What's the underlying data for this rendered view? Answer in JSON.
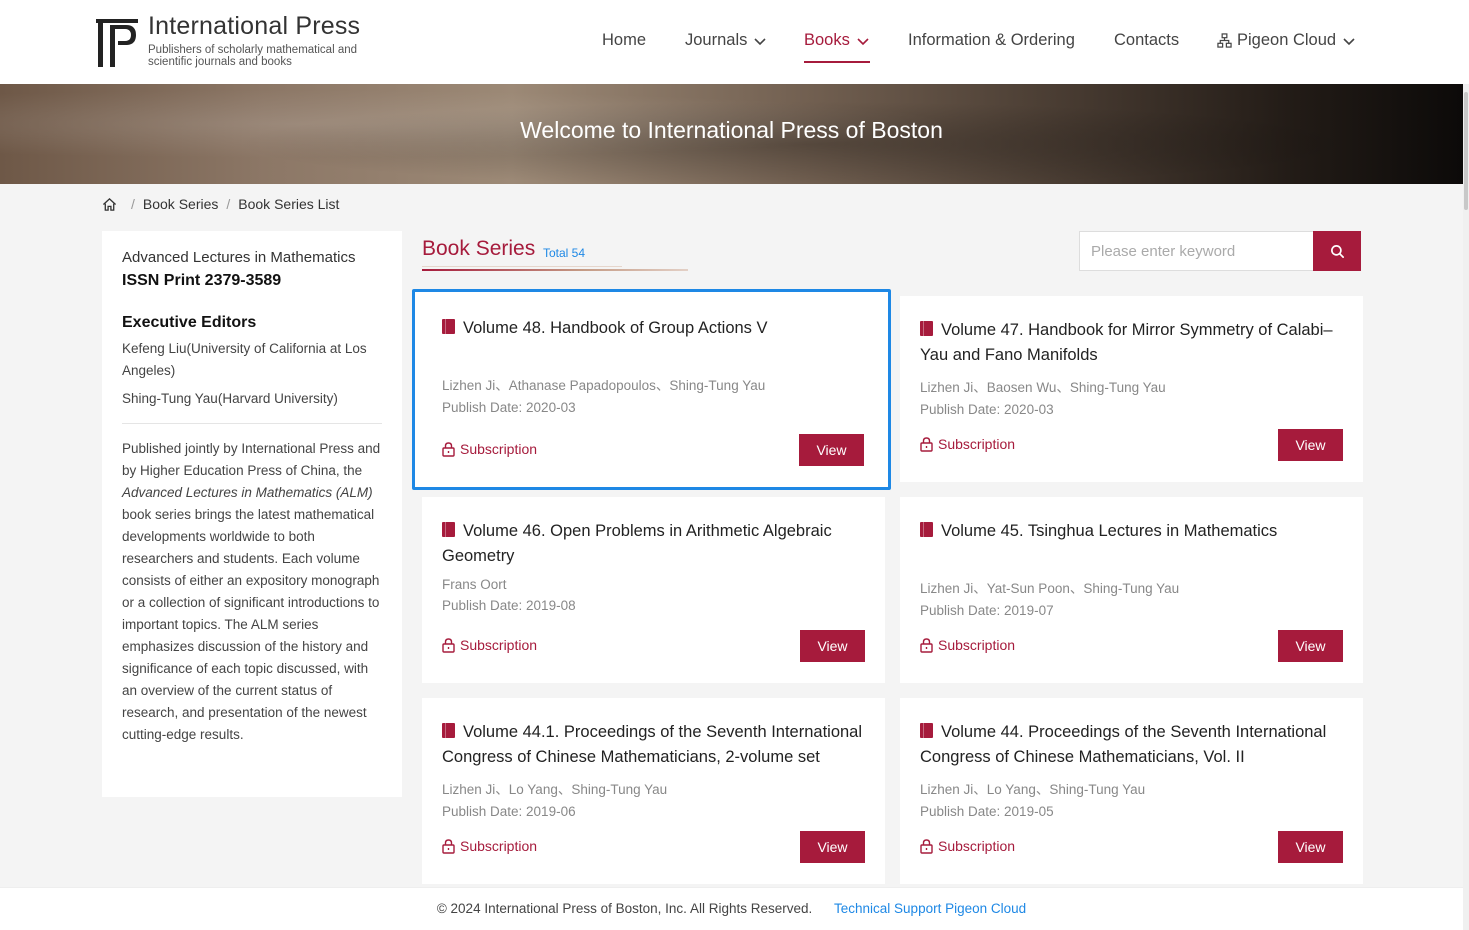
{
  "header": {
    "brand_title": "International Press",
    "brand_subtitle": "Publishers of scholarly mathematical and scientific journals and books",
    "nav": [
      {
        "label": "Home"
      },
      {
        "label": "Journals"
      },
      {
        "label": "Books"
      },
      {
        "label": "Information & Ordering"
      },
      {
        "label": "Contacts"
      },
      {
        "label": "Pigeon Cloud"
      }
    ],
    "accent_color": "#a61b3c"
  },
  "banner": {
    "title": "Welcome to International Press of Boston"
  },
  "breadcrumb": {
    "items": [
      "Book Series",
      "Book Series List"
    ]
  },
  "sidebar": {
    "series_name": "Advanced Lectures in Mathematics",
    "issn": "ISSN Print 2379-3589",
    "editors_heading": "Executive Editors",
    "editors": [
      "Kefeng Liu(University of California at Los Angeles)",
      "Shing-Tung Yau(Harvard University)"
    ],
    "description_pre": "Published jointly by International Press and by Higher Education Press of China, the ",
    "description_em": "Advanced Lectures in Mathematics (ALM)",
    "description_post": " book series brings the latest mathematical developments worldwide to both researchers and students. Each volume consists of either an expository monograph or a collection of significant introductions to important topics. The ALM series emphasizes discussion of the history and significance of each topic discussed, with an overview of the current status of research, and presentation of the newest cutting-edge results."
  },
  "content": {
    "section_title": "Book Series",
    "total": "Total 54",
    "search_placeholder": "Please enter keyword",
    "cards": [
      {
        "title": "Volume 48. Handbook of Group Actions V",
        "authors": "Lizhen Ji、Athanase Papadopoulos、Shing-Tung Yau",
        "date": "Publish Date: 2020-03",
        "subscription": "Subscription",
        "view": "View"
      },
      {
        "title": "Volume 47. Handbook for Mirror Symmetry of Calabi–Yau and Fano Manifolds",
        "authors": "Lizhen Ji、Baosen Wu、Shing-Tung Yau",
        "date": "Publish Date: 2020-03",
        "subscription": "Subscription",
        "view": "View"
      },
      {
        "title": "Volume 46. Open Problems in Arithmetic Algebraic Geometry",
        "authors": "Frans Oort",
        "date": "Publish Date: 2019-08",
        "subscription": "Subscription",
        "view": "View"
      },
      {
        "title": "Volume 45. Tsinghua Lectures in Mathematics",
        "authors": "Lizhen Ji、Yat-Sun Poon、Shing-Tung Yau",
        "date": "Publish Date: 2019-07",
        "subscription": "Subscription",
        "view": "View"
      },
      {
        "title": "Volume 44.1. Proceedings of the Seventh International Congress of Chinese Mathematicians, 2-volume set",
        "authors": "Lizhen Ji、Lo Yang、Shing-Tung Yau",
        "date": "Publish Date: 2019-06",
        "subscription": "Subscription",
        "view": "View"
      },
      {
        "title": "Volume 44. Proceedings of the Seventh International Congress of Chinese Mathematicians, Vol. II",
        "authors": "Lizhen Ji、Lo Yang、Shing-Tung Yau",
        "date": "Publish Date: 2019-05",
        "subscription": "Subscription",
        "view": "View"
      }
    ]
  },
  "footer": {
    "copyright": "© 2024 International Press of Boston, Inc. All Rights Reserved.",
    "tech_support": "Technical Support Pigeon Cloud"
  }
}
